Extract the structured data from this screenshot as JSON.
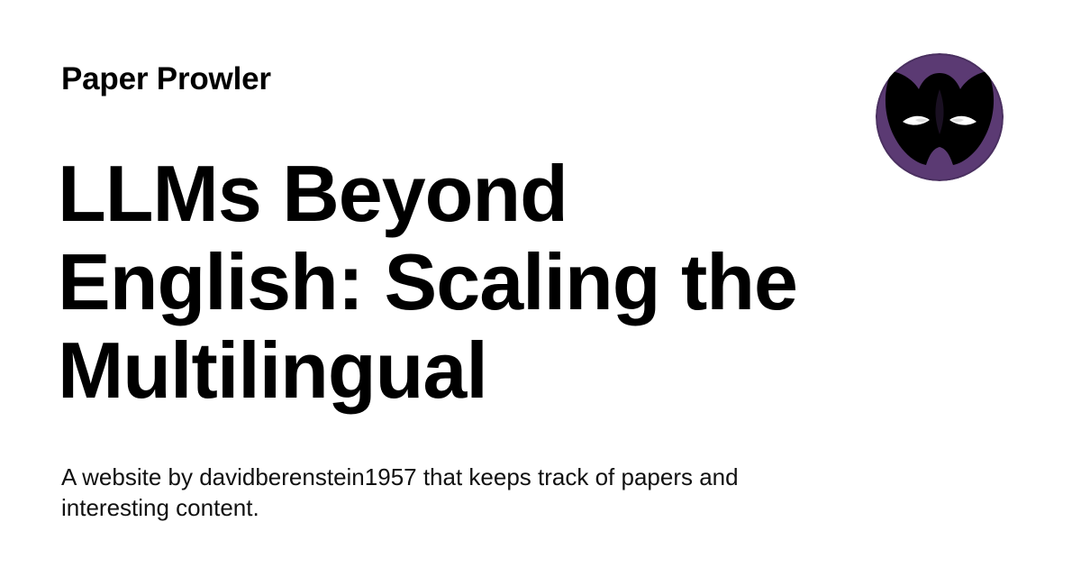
{
  "site": {
    "name": "Paper Prowler"
  },
  "article": {
    "title": "LLMs Beyond English: Scaling the Multilingual"
  },
  "footer": {
    "description": "A website by davidberenstein1957 that keeps track of papers and interesting content."
  },
  "avatar": {
    "icon": "masked-face-icon",
    "background_color": "#5b3a73",
    "mask_color": "#000000",
    "eye_color": "#ffffff"
  }
}
